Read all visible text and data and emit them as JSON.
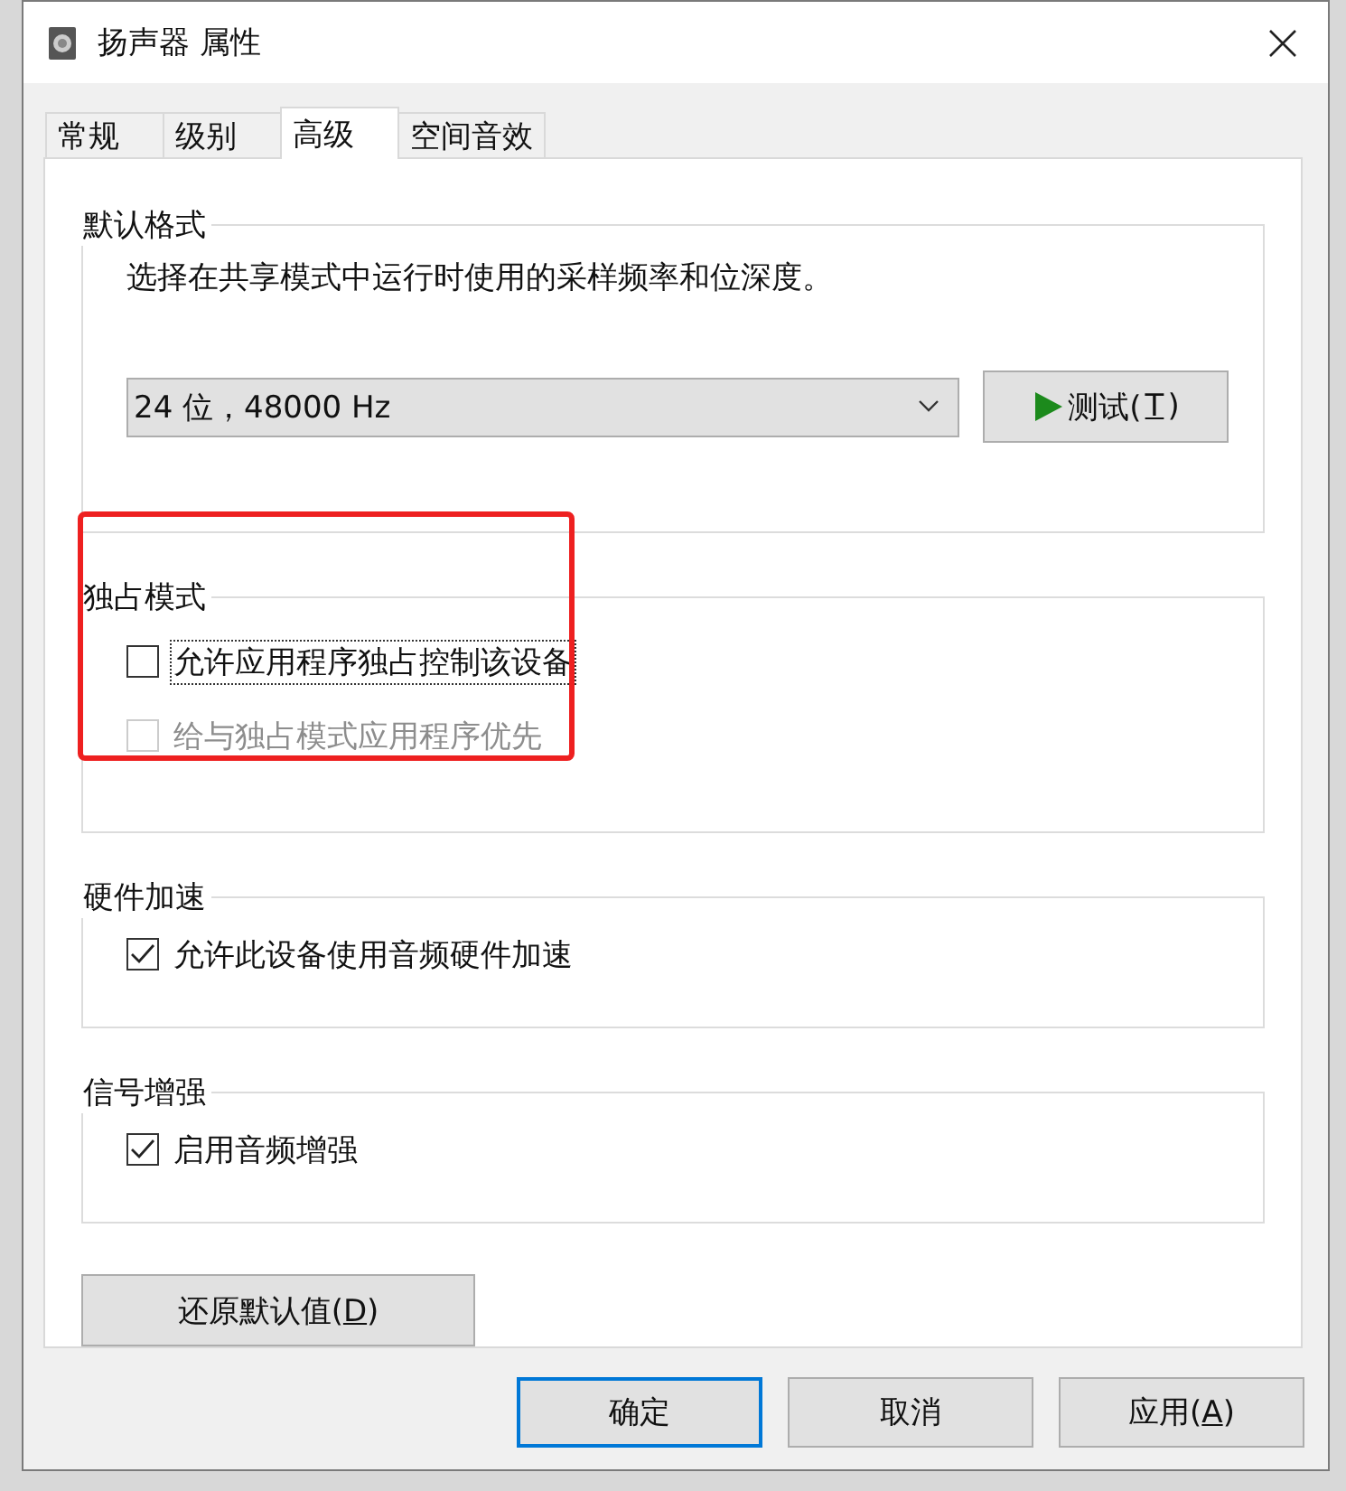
{
  "window": {
    "title": "扬声器 属性"
  },
  "tabs": [
    {
      "label": "常规",
      "selected": false
    },
    {
      "label": "级别",
      "selected": false
    },
    {
      "label": "高级",
      "selected": true
    },
    {
      "label": "空间音效",
      "selected": false
    }
  ],
  "default_format": {
    "title": "默认格式",
    "description": "选择在共享模式中运行时使用的采样频率和位深度。",
    "format_value": "24 位，48000 Hz",
    "test_button": {
      "label_before": "测试(",
      "access_key": "T",
      "label_after": ")"
    }
  },
  "groups": [
    {
      "title": "独占模式",
      "highlighted": true,
      "options": [
        {
          "label": "允许应用程序独占控制该设备",
          "checked": false,
          "disabled": false,
          "focused": true
        },
        {
          "label": "给与独占模式应用程序优先",
          "checked": false,
          "disabled": true,
          "focused": false
        }
      ]
    },
    {
      "title": "硬件加速",
      "highlighted": false,
      "options": [
        {
          "label": "允许此设备使用音频硬件加速",
          "checked": true,
          "disabled": false,
          "focused": false
        }
      ]
    },
    {
      "title": "信号增强",
      "highlighted": false,
      "options": [
        {
          "label": "启用音频增强",
          "checked": true,
          "disabled": false,
          "focused": false
        }
      ]
    }
  ],
  "restore_button": {
    "label_before": "还原默认值(",
    "access_key": "D",
    "label_after": ")"
  },
  "footer_buttons": [
    {
      "label_before": "确定",
      "focused": true
    },
    {
      "label_before": "取消",
      "focused": false
    },
    {
      "label_before": "应用(",
      "access_key": "A",
      "label_after": ")",
      "focused": false
    }
  ]
}
